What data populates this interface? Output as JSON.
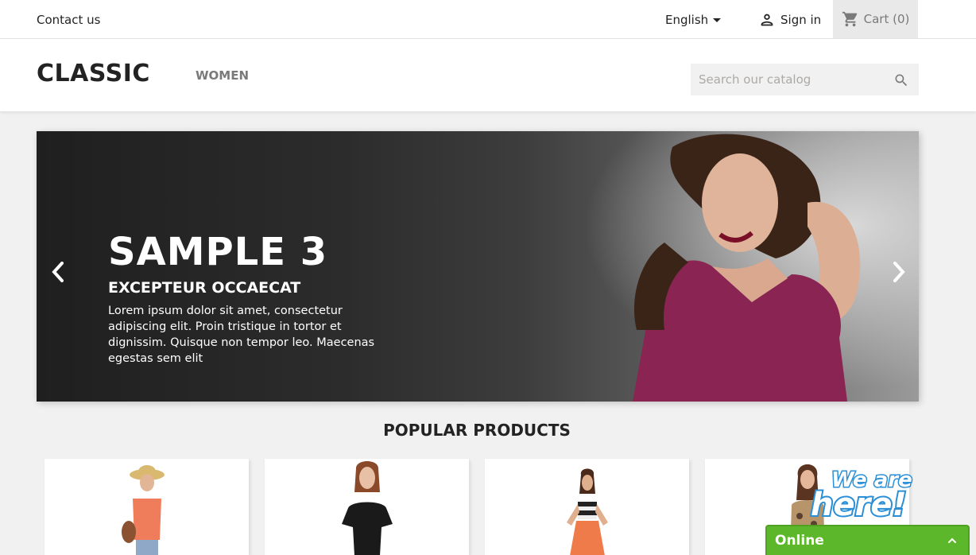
{
  "topbar": {
    "contact": "Contact us",
    "language": "English",
    "signin": "Sign in",
    "cart": "Cart",
    "cart_count": "(0)"
  },
  "header": {
    "logo": "CLASSIC",
    "nav_women": "WOMEN",
    "search_placeholder": "Search our catalog"
  },
  "slider": {
    "title": "SAMPLE 3",
    "subtitle": "EXCEPTEUR OCCAECAT",
    "description": "Lorem ipsum dolor sit amet, consectetur adipiscing elit. Proin tristique in tortor et dignissim. Quisque non tempor leo. Maecenas egestas sem elit"
  },
  "products": {
    "title": "POPULAR PRODUCTS"
  },
  "chat": {
    "status": "Online",
    "badge": "We are here!"
  },
  "colors": {
    "accent": "#5cb82a",
    "badge_blue": "#2a8fd6"
  }
}
